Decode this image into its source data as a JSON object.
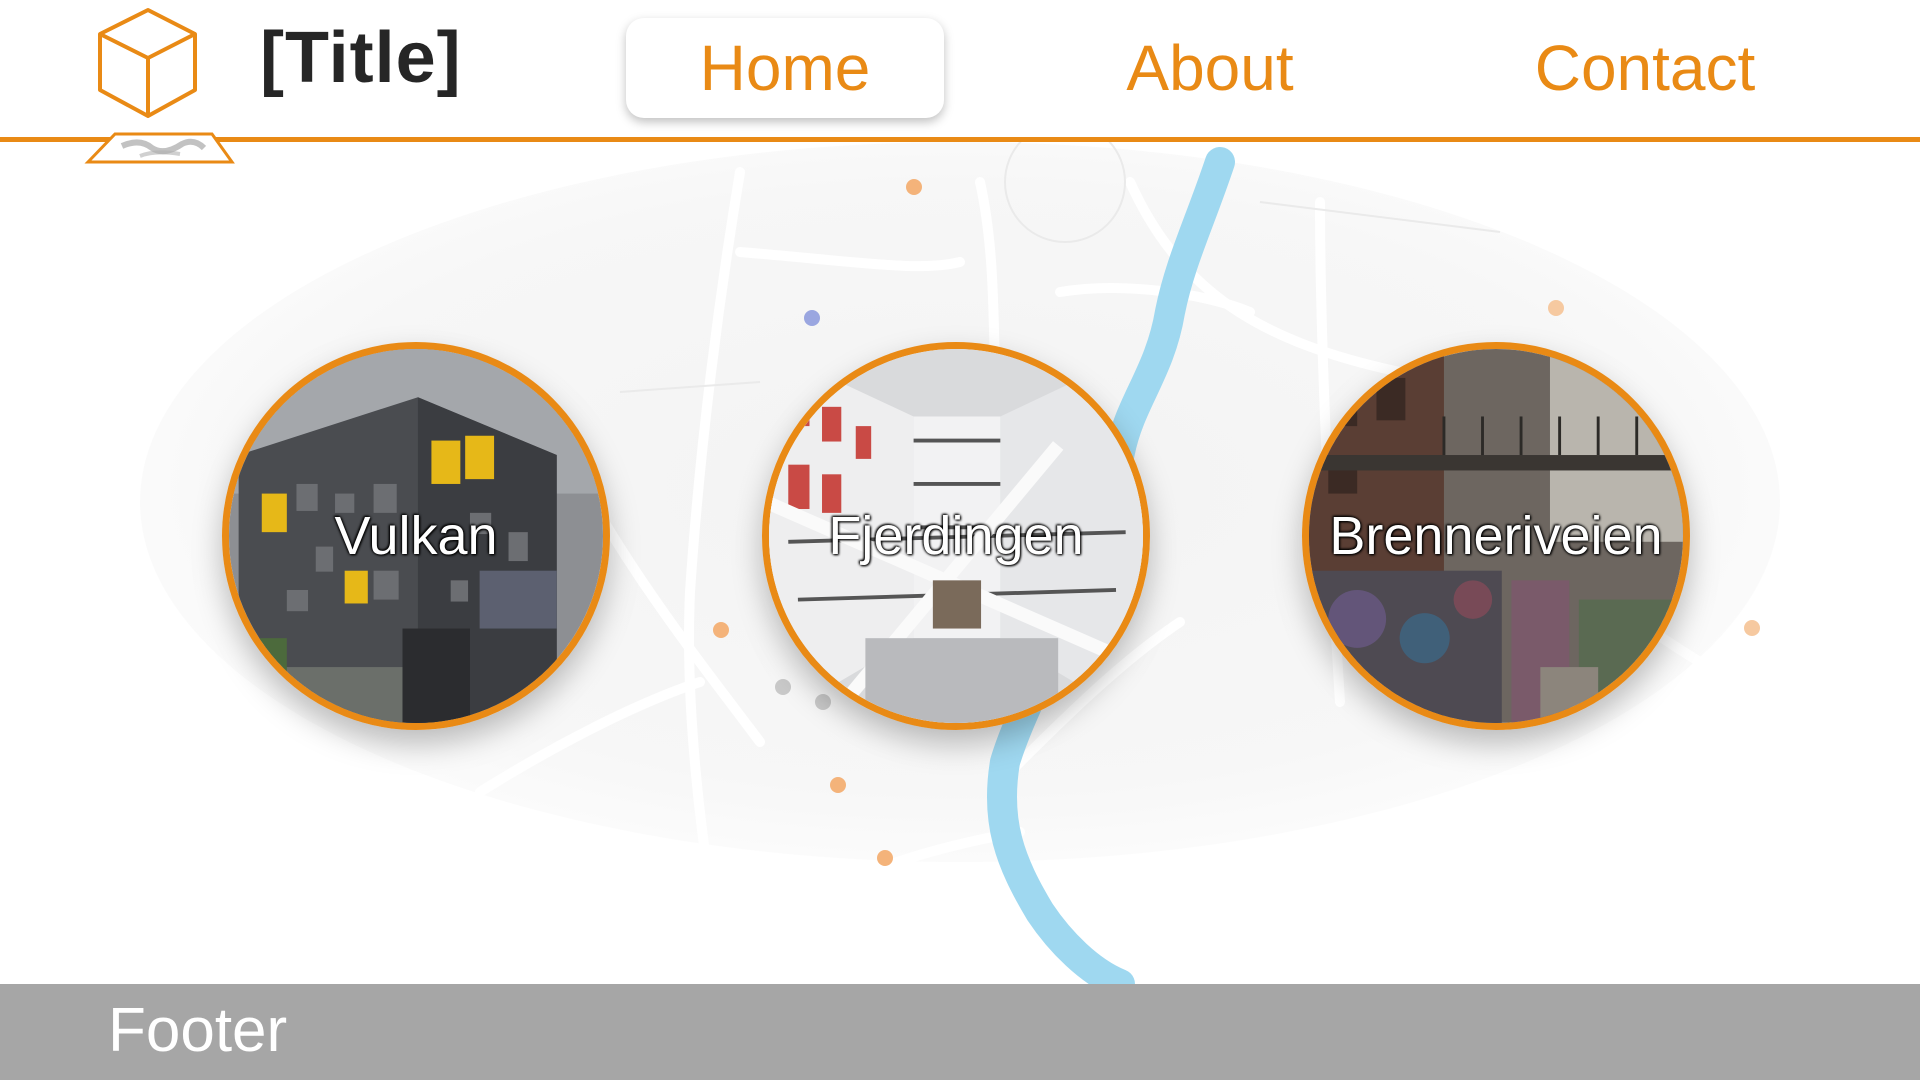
{
  "header": {
    "title": "[Title]",
    "nav": [
      {
        "label": "Home",
        "active": true
      },
      {
        "label": "About",
        "active": false
      },
      {
        "label": "Contact",
        "active": false
      }
    ]
  },
  "locations": [
    {
      "label": "Vulkan"
    },
    {
      "label": "Fjerdingen"
    },
    {
      "label": "Brenneriveien"
    }
  ],
  "footer": {
    "text": "Footer"
  },
  "colors": {
    "accent": "#e98a15",
    "title_text": "#262626",
    "footer_bg": "#a6a6a6",
    "river": "#9fd8f0"
  },
  "icons": [
    "cube-logo-icon",
    "map-pin-icon"
  ]
}
